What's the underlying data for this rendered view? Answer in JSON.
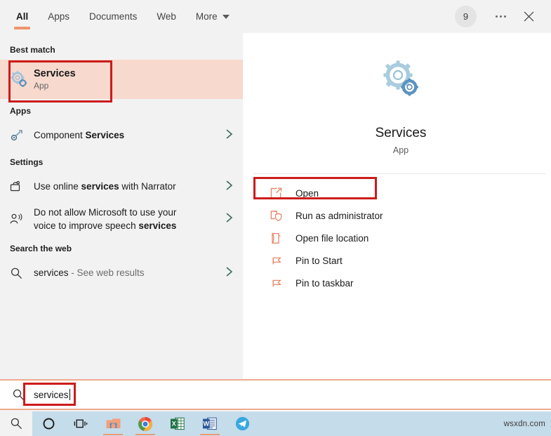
{
  "header": {
    "tabs": [
      {
        "label": "All",
        "active": true
      },
      {
        "label": "Apps",
        "active": false
      },
      {
        "label": "Documents",
        "active": false
      },
      {
        "label": "Web",
        "active": false
      },
      {
        "label": "More",
        "active": false,
        "caret": true
      }
    ],
    "avatar_badge": "9",
    "more_button": "more-options",
    "close_button": "close"
  },
  "left": {
    "groups": [
      {
        "label": "Best match"
      },
      {
        "label": "Apps"
      },
      {
        "label": "Settings"
      },
      {
        "label": "Search the web"
      }
    ],
    "best_match": {
      "title": "Services",
      "subtitle": "App",
      "icon": "services-gears-icon"
    },
    "apps": [
      {
        "text_plain": "Component ",
        "text_bold": "Services",
        "icon": "component-services-icon",
        "chevron": "›"
      }
    ],
    "settings": [
      {
        "parts": [
          {
            "t": "Use online ",
            "b": false
          },
          {
            "t": "services",
            "b": true
          },
          {
            "t": " with Narrator",
            "b": false
          }
        ],
        "icon": "narrator-icon",
        "chevron": "›"
      },
      {
        "parts": [
          {
            "t": "Do not allow Microsoft to use your",
            "b": false
          },
          {
            "t": "\n",
            "b": false
          },
          {
            "t": "voice to improve speech ",
            "b": false
          },
          {
            "t": "services",
            "b": true
          }
        ],
        "icon": "voice-speech-icon",
        "chevron": "›"
      }
    ],
    "web": [
      {
        "query": "services",
        "suffix": " - See web results",
        "icon": "search-icon",
        "chevron": "›"
      }
    ]
  },
  "right": {
    "app_icon": "services-gears-icon",
    "app_name": "Services",
    "app_kind": "App",
    "actions": [
      {
        "label": "Open",
        "icon": "open-icon",
        "highlighted": true
      },
      {
        "label": "Run as administrator",
        "icon": "shield-run-icon",
        "highlighted": false
      },
      {
        "label": "Open file location",
        "icon": "folder-location-icon",
        "highlighted": false
      },
      {
        "label": "Pin to Start",
        "icon": "pin-icon",
        "highlighted": false
      },
      {
        "label": "Pin to taskbar",
        "icon": "pin-icon",
        "highlighted": false
      }
    ]
  },
  "search": {
    "value": "services",
    "icon": "search-icon"
  },
  "taskbar": {
    "items": [
      {
        "name": "start-button",
        "icon": "search-icon",
        "running": false
      },
      {
        "name": "cortana-button",
        "icon": "cortana-circle-icon",
        "running": false
      },
      {
        "name": "task-view-button",
        "icon": "task-view-icon",
        "running": false
      },
      {
        "name": "file-explorer-button",
        "icon": "file-explorer-icon",
        "running": true
      },
      {
        "name": "chrome-button",
        "icon": "chrome-icon",
        "running": true
      },
      {
        "name": "excel-button",
        "icon": "excel-icon",
        "running": false
      },
      {
        "name": "word-button",
        "icon": "word-icon",
        "running": true
      },
      {
        "name": "telegram-button",
        "icon": "telegram-icon",
        "running": false
      }
    ],
    "watermark": "wsxdn.com"
  },
  "colors": {
    "accent_underline": "#f0946d",
    "annotation_red": "#cc1b1b",
    "best_match_bg": "#f7d9cd",
    "action_icon": "#e8876a",
    "taskbar_bg": "#c5dcea",
    "pane_bg": "#f2f2f2"
  }
}
